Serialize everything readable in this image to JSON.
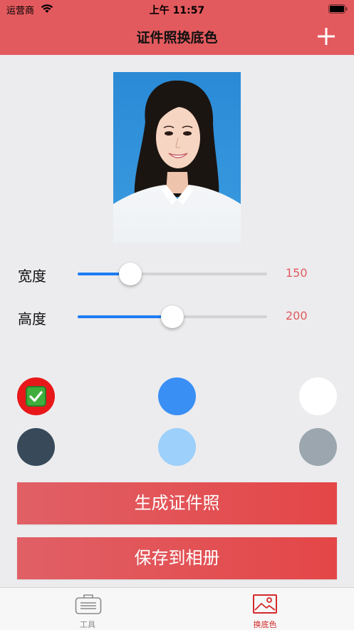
{
  "status_bar": {
    "carrier": "运营商",
    "time": "上午 11:57"
  },
  "nav": {
    "title": "证件照换底色",
    "add_icon": "plus-icon"
  },
  "colors": {
    "header": "#e35a5e",
    "accent_blue": "#1e7cf2",
    "value_red": "#e05a5c"
  },
  "sliders": [
    {
      "label": "宽度",
      "value": "150",
      "fraction": 0.28
    },
    {
      "label": "高度",
      "value": "200",
      "fraction": 0.5
    }
  ],
  "swatches": [
    {
      "name": "red",
      "color": "#e8171a",
      "selected": true,
      "selected_icon": "check-mark-icon"
    },
    {
      "name": "blue",
      "color": "#3a8ff5",
      "selected": false
    },
    {
      "name": "white",
      "color": "#ffffff",
      "selected": false
    },
    {
      "name": "dark-slate",
      "color": "#384a5a",
      "selected": false
    },
    {
      "name": "light-blue",
      "color": "#9dd0fb",
      "selected": false
    },
    {
      "name": "gray",
      "color": "#9ba6ae",
      "selected": false
    }
  ],
  "buttons": {
    "generate": "生成证件照",
    "save": "保存到相册"
  },
  "tabs": [
    {
      "label": "工具",
      "icon": "toolbox-icon",
      "active": false,
      "color": "#8a8a8a"
    },
    {
      "label": "换底色",
      "icon": "image-icon",
      "active": true,
      "color": "#d42a2a"
    }
  ]
}
